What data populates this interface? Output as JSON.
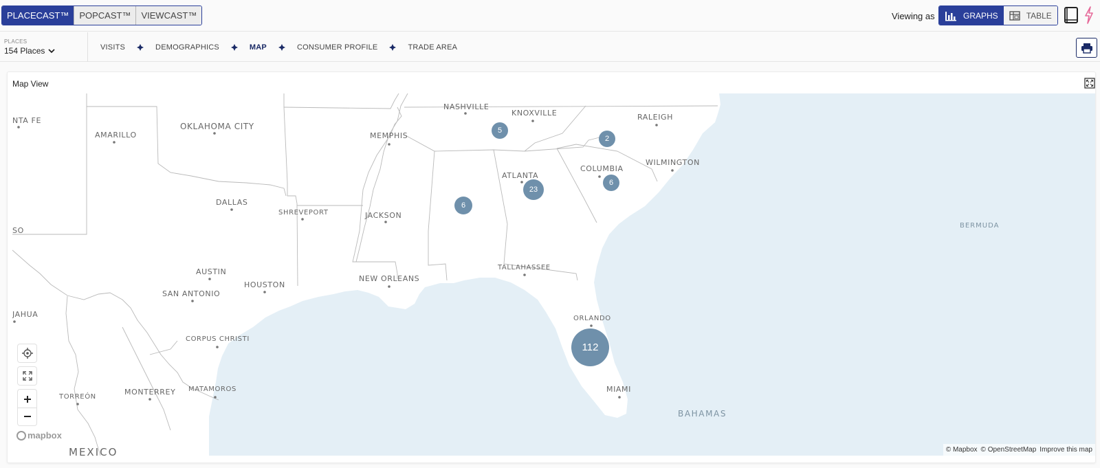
{
  "products": [
    {
      "label": "PLACECAST™",
      "active": true
    },
    {
      "label": "POPCAST™",
      "active": false
    },
    {
      "label": "VIEWCAST™",
      "active": false
    }
  ],
  "header": {
    "viewing_label": "Viewing as",
    "views": [
      {
        "label": "GRAPHS",
        "icon": "bar-chart-icon",
        "active": true
      },
      {
        "label": "TABLE",
        "icon": "table-icon",
        "active": false
      }
    ]
  },
  "places": {
    "label": "PLACES",
    "value": "154 Places"
  },
  "nav": {
    "tabs": [
      {
        "label": "VISITS",
        "active": false
      },
      {
        "label": "DEMOGRAPHICS",
        "active": false
      },
      {
        "label": "MAP",
        "active": true
      },
      {
        "label": "CONSUMER PROFILE",
        "active": false
      },
      {
        "label": "TRADE AREA",
        "active": false
      }
    ]
  },
  "card": {
    "title": "Map View"
  },
  "map": {
    "city_labels": [
      "NTA FE",
      "AMARILLO",
      "OKLAHOMA CITY",
      "NASHVILLE",
      "KNOXVILLE",
      "RALEIGH",
      "MEMPHIS",
      "COLUMBIA",
      "WILMINGTON",
      "ATLANTA",
      "DALLAS",
      "SHREVEPORT",
      "JACKSON",
      "SO",
      "AUSTIN",
      "HOUSTON",
      "SAN ANTONIO",
      "NEW ORLEANS",
      "TALLAHASSEE",
      "JAHUA",
      "CORPUS CHRISTI",
      "ORLANDO",
      "MIAMI",
      "MATAMOROS",
      "TORREÓN",
      "MONTERREY",
      "MEXICO"
    ],
    "region_labels": [
      "BERMUDA",
      "BAHAMAS"
    ],
    "clusters": [
      "5",
      "2",
      "23",
      "6",
      "6",
      "112"
    ],
    "attribution": [
      "© Mapbox",
      "© OpenStreetMap",
      "Improve this map"
    ],
    "logo": "mapbox",
    "colors": {
      "cluster": "#6f90ab",
      "water": "#e4eff6",
      "land": "#ffffff",
      "accent": "#2a3f9a"
    }
  }
}
